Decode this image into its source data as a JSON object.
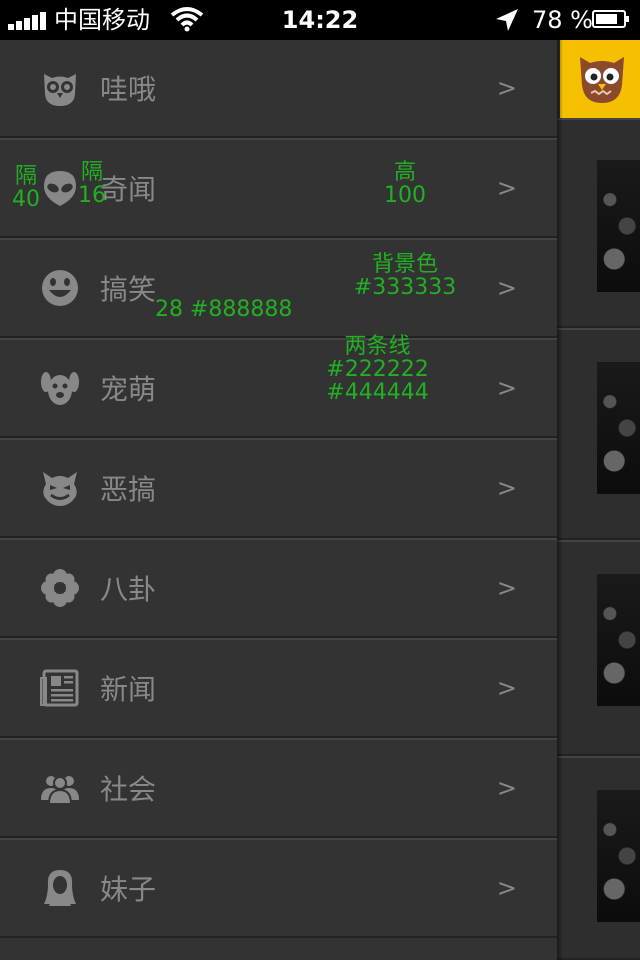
{
  "status_bar": {
    "carrier": "中国移动",
    "time": "14:22",
    "battery": "78 %"
  },
  "menu": {
    "items": [
      {
        "label": "哇哦",
        "icon": "owl-icon",
        "arrow": ">"
      },
      {
        "label": "奇闻",
        "icon": "alien-icon",
        "arrow": ">"
      },
      {
        "label": "搞笑",
        "icon": "smiley-icon",
        "arrow": ">"
      },
      {
        "label": "宠萌",
        "icon": "dog-icon",
        "arrow": ">"
      },
      {
        "label": "恶搞",
        "icon": "devil-icon",
        "arrow": ">"
      },
      {
        "label": "八卦",
        "icon": "flower-icon",
        "arrow": ">"
      },
      {
        "label": "新闻",
        "icon": "newspaper-icon",
        "arrow": ">"
      },
      {
        "label": "社会",
        "icon": "people-icon",
        "arrow": ">"
      },
      {
        "label": "妹子",
        "icon": "woman-icon",
        "arrow": ">"
      }
    ]
  },
  "annotations": {
    "gap_left_label": "隔",
    "gap_left_value": "40",
    "gap_mid_label": "隔",
    "gap_mid_value": "16",
    "height_label": "高",
    "height_value": "100",
    "bg_label": "背景色",
    "bg_value": "#333333",
    "font_spec": "28 #888888",
    "lines_label": "两条线",
    "line1": "#222222",
    "line2": "#444444"
  },
  "colors": {
    "menu_bg": "#333333",
    "text": "#888888",
    "line_dark": "#222222",
    "line_light": "#444444",
    "accent": "#f5c000",
    "annotation": "#22b022"
  }
}
